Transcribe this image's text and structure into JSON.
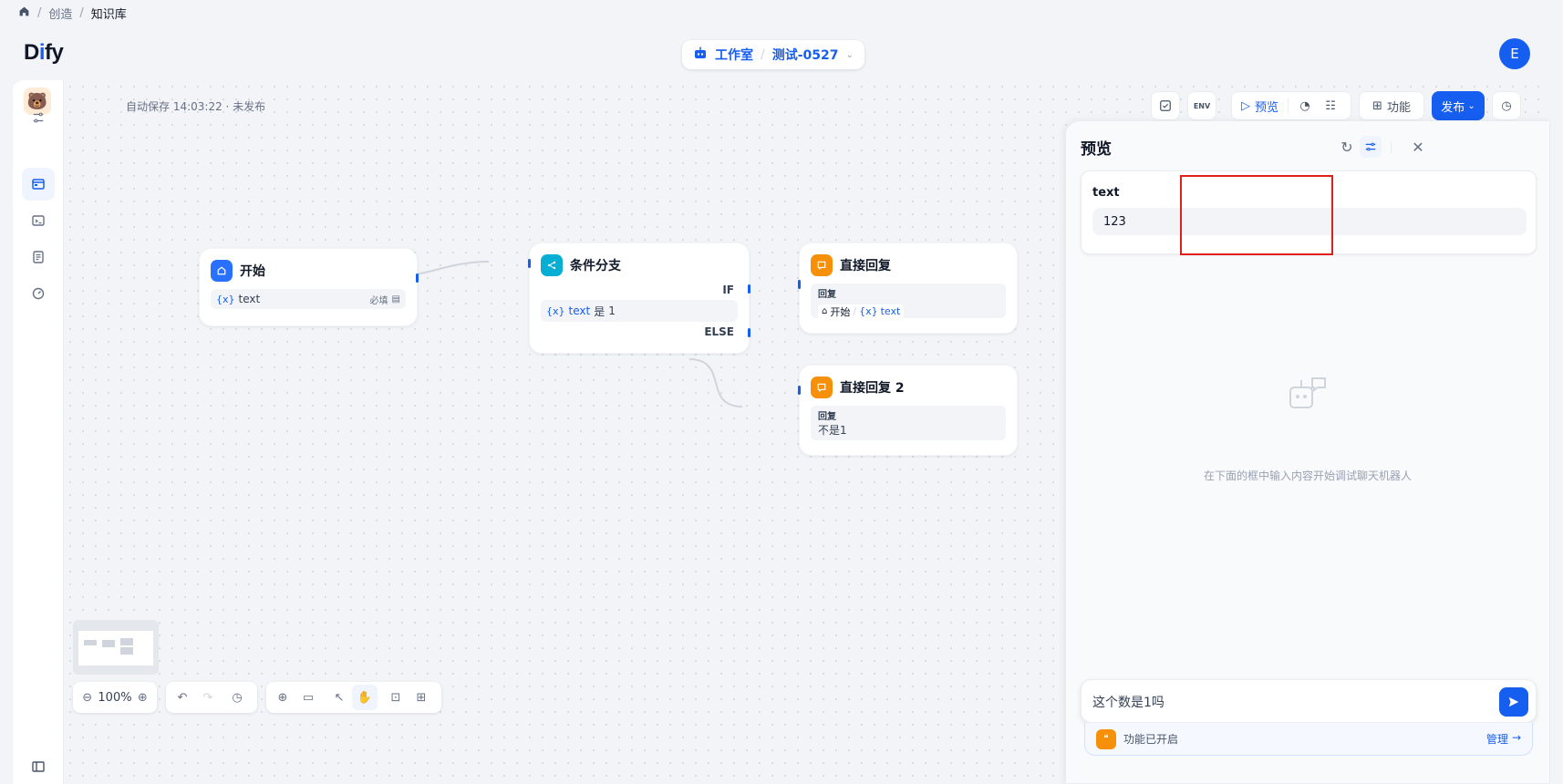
{
  "breadcrumb": {
    "items": [
      "创造",
      "知识库"
    ]
  },
  "logo": {
    "d": "D",
    "i": "i",
    "fy": "fy"
  },
  "header": {
    "studio": "工作室",
    "app_name": "测试-0527",
    "avatar_letter": "E"
  },
  "workflow": {
    "autosave": "自动保存 14:03:22 · 未发布"
  },
  "toolbar": {
    "preview": "预览",
    "features": "功能",
    "publish": "发布"
  },
  "nodes": {
    "start": {
      "title": "开始",
      "var_badge": "{x}",
      "var": "text",
      "required": "必填"
    },
    "ifelse": {
      "title": "条件分支",
      "if": "IF",
      "else": "ELSE",
      "var_badge": "{x}",
      "var": "text",
      "op": "是",
      "value": "1"
    },
    "answer1": {
      "title": "直接回复",
      "label": "回复",
      "ref_node": "开始",
      "var_badge": "{x}",
      "var": "text"
    },
    "answer2": {
      "title": "直接回复 2",
      "label": "回复",
      "text": "不是1"
    }
  },
  "preview": {
    "title": "预览",
    "field_label": "text",
    "field_value": "123",
    "empty_hint": "在下面的框中输入内容开始调试聊天机器人",
    "chat_value": "这个数是1吗",
    "features_on": "功能已开启",
    "manage": "管理"
  },
  "zoom": {
    "level": "100%"
  },
  "colors": {
    "primary": "#155eef",
    "orange": "#f79009",
    "cyan": "#06aed4",
    "highlight": "#e0201a"
  }
}
